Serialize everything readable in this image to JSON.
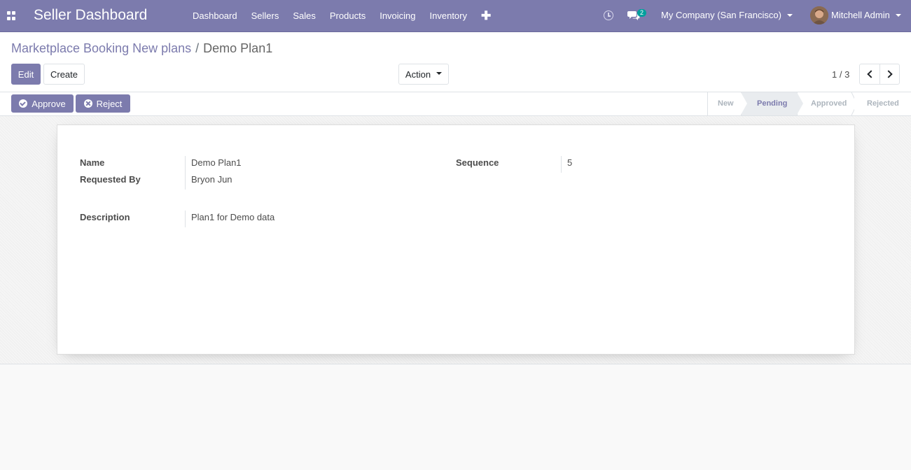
{
  "navbar": {
    "brand": "Seller Dashboard",
    "menu": [
      "Dashboard",
      "Sellers",
      "Sales",
      "Products",
      "Invoicing",
      "Inventory"
    ],
    "plus": "✚",
    "chat_badge": "2",
    "company": "My Company (San Francisco)",
    "user": "Mitchell Admin"
  },
  "breadcrumb": {
    "parent": "Marketplace Booking New plans",
    "separator": "/",
    "current": "Demo Plan1"
  },
  "toolbar": {
    "edit_label": "Edit",
    "create_label": "Create",
    "action_label": "Action",
    "pager": "1 / 3"
  },
  "statusbar": {
    "approve_label": "Approve",
    "reject_label": "Reject",
    "stages": [
      "New",
      "Pending",
      "Approved",
      "Rejected"
    ],
    "active_stage": "Pending"
  },
  "form": {
    "name_label": "Name",
    "name_value": "Demo Plan1",
    "requested_by_label": "Requested By",
    "requested_by_value": "Bryon Jun",
    "sequence_label": "Sequence",
    "sequence_value": "5",
    "description_label": "Description",
    "description_value": "Plan1 for Demo data"
  },
  "colors": {
    "brand": "#7c7bad",
    "badge": "#00a09d"
  }
}
